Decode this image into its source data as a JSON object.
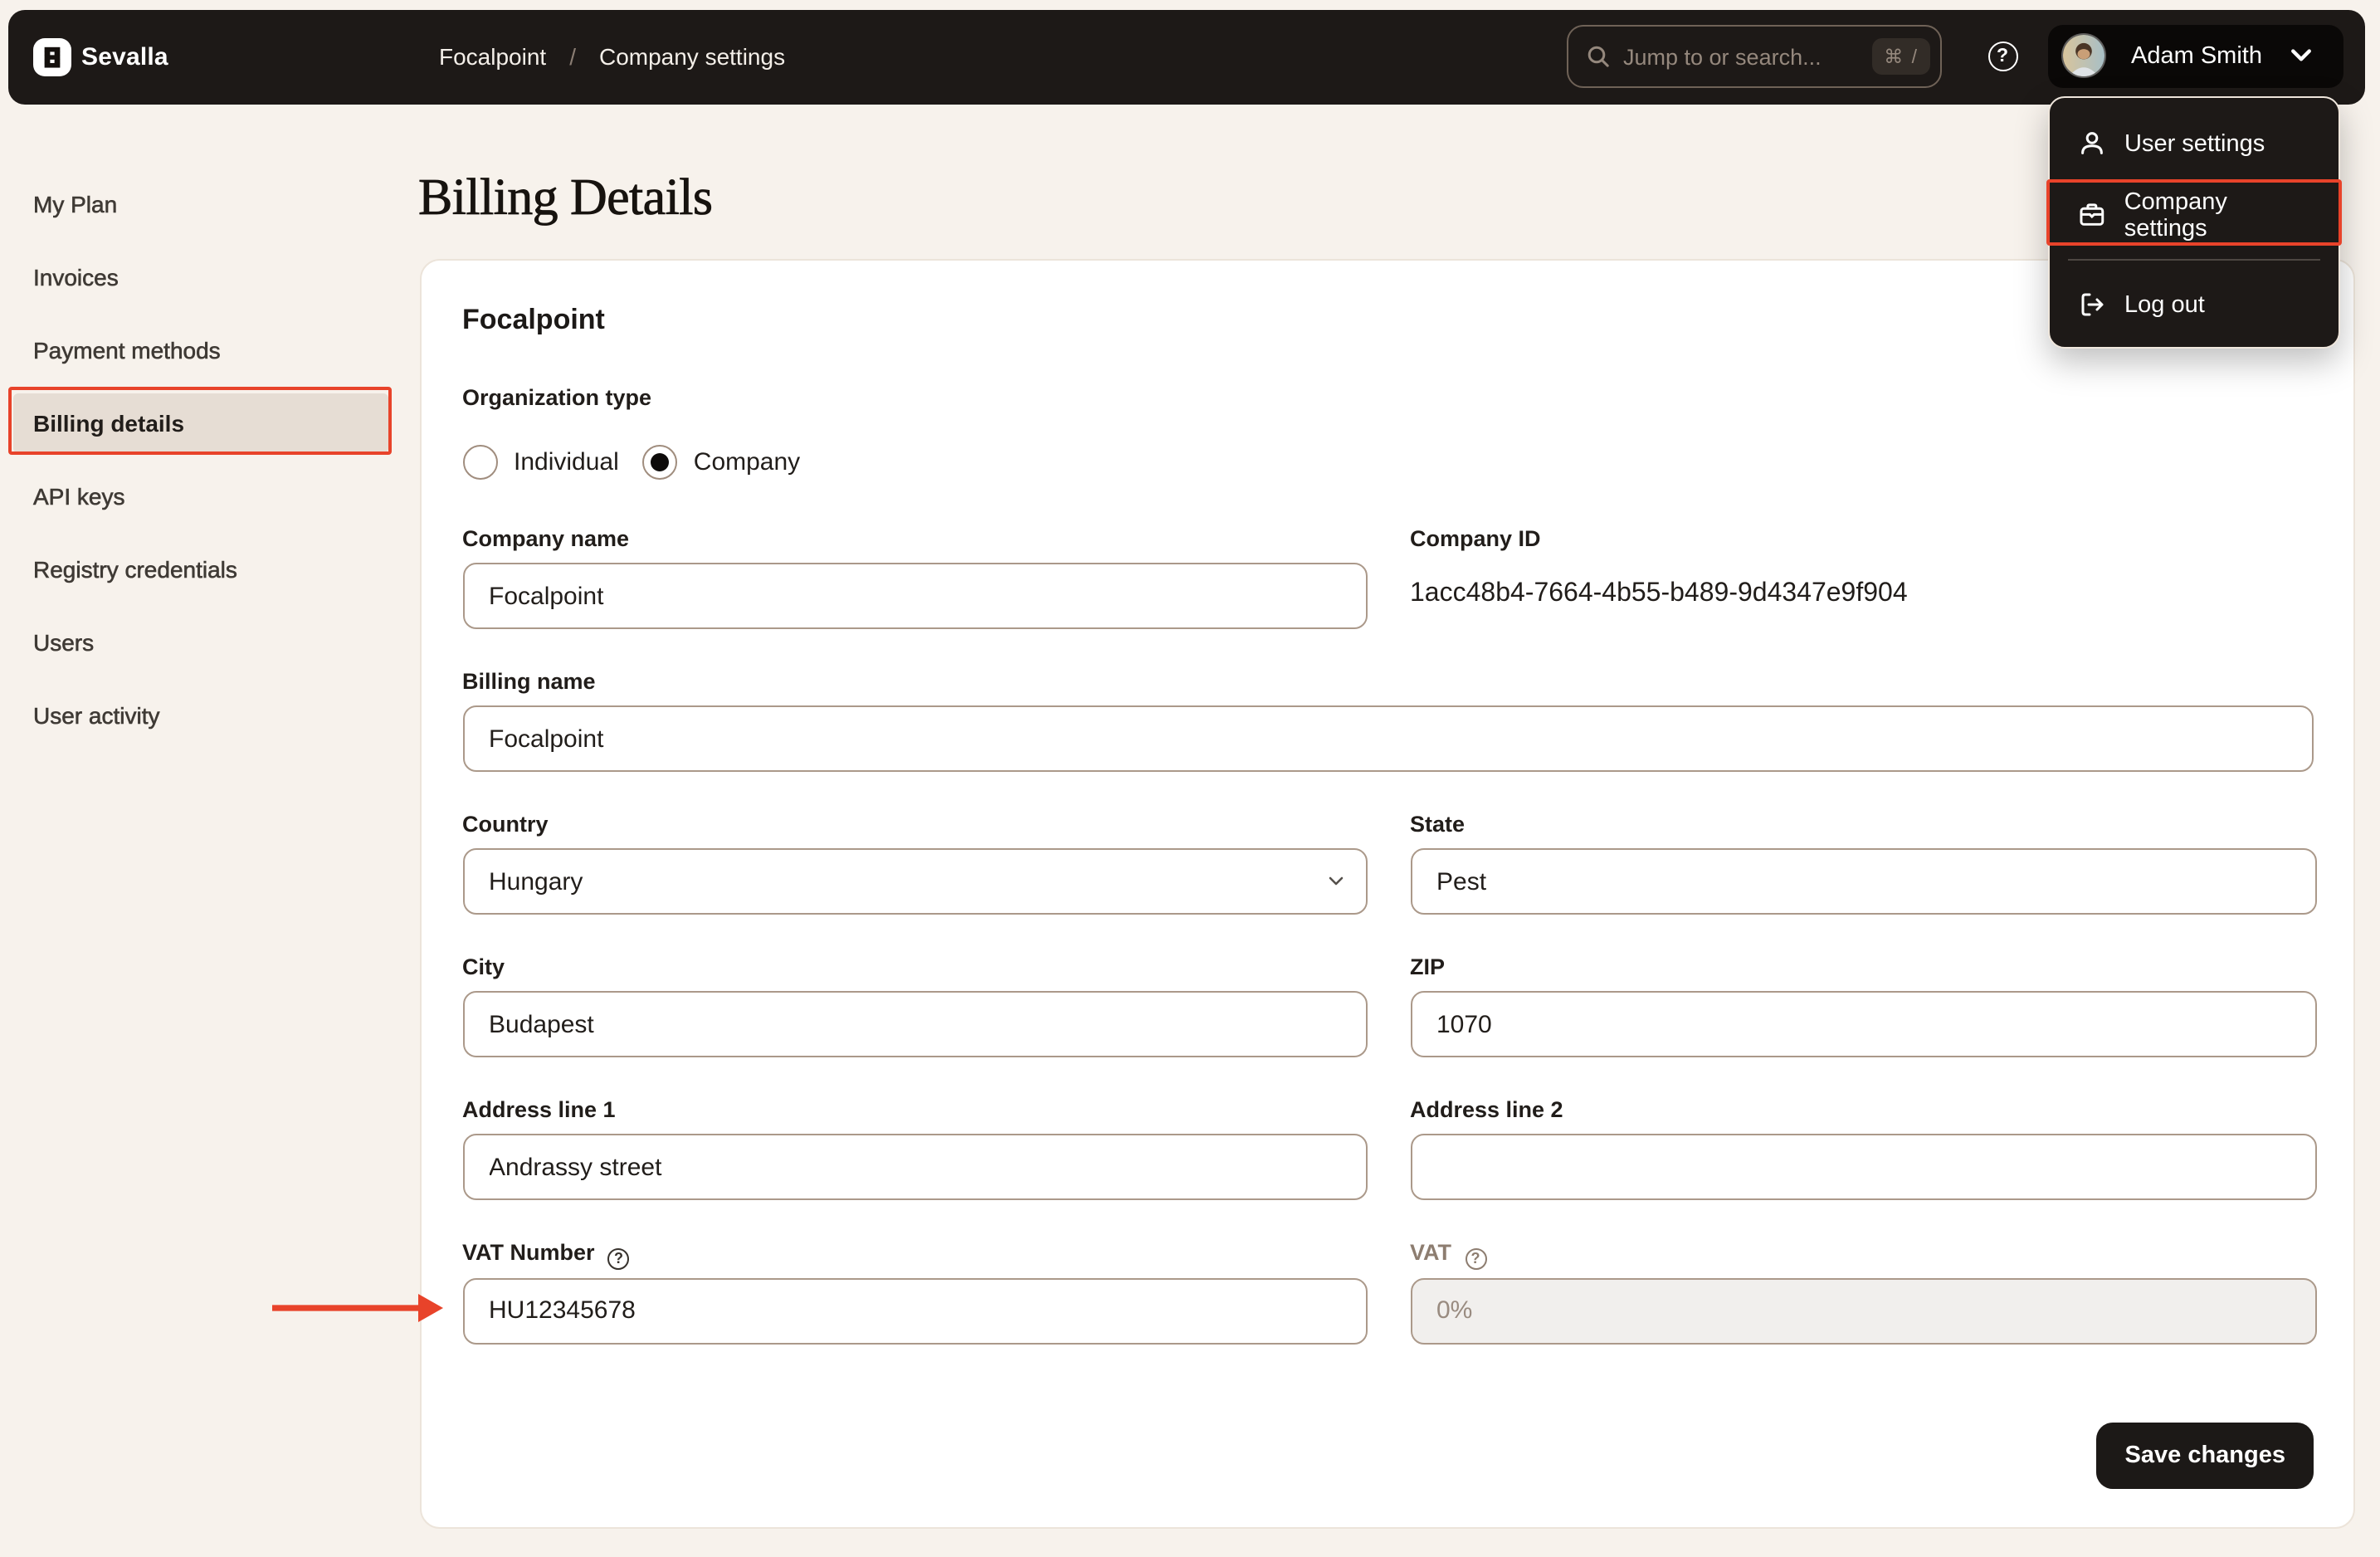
{
  "brand": {
    "name": "Sevalla"
  },
  "breadcrumb": {
    "app": "Focalpoint",
    "separator": "/",
    "page": "Company settings"
  },
  "search": {
    "placeholder": "Jump to or search...",
    "shortcut": "⌘ /"
  },
  "user": {
    "name": "Adam Smith"
  },
  "user_menu": {
    "items": [
      {
        "label": "User settings"
      },
      {
        "label": "Company settings"
      },
      {
        "label": "Log out"
      }
    ]
  },
  "sidebar": {
    "items": [
      {
        "label": "My Plan"
      },
      {
        "label": "Invoices"
      },
      {
        "label": "Payment methods"
      },
      {
        "label": "Billing details"
      },
      {
        "label": "API keys"
      },
      {
        "label": "Registry credentials"
      },
      {
        "label": "Users"
      },
      {
        "label": "User activity"
      }
    ]
  },
  "page": {
    "title": "Billing Details"
  },
  "form": {
    "card_title": "Focalpoint",
    "org_type": {
      "label": "Organization type",
      "options": [
        {
          "label": "Individual",
          "selected": false
        },
        {
          "label": "Company",
          "selected": true
        }
      ]
    },
    "company_name": {
      "label": "Company name",
      "value": "Focalpoint"
    },
    "company_id": {
      "label": "Company ID",
      "value": "1acc48b4-7664-4b55-b489-9d4347e9f904"
    },
    "billing_name": {
      "label": "Billing name",
      "value": "Focalpoint"
    },
    "country": {
      "label": "Country",
      "value": "Hungary"
    },
    "state": {
      "label": "State",
      "value": "Pest"
    },
    "city": {
      "label": "City",
      "value": "Budapest"
    },
    "zip": {
      "label": "ZIP",
      "value": "1070"
    },
    "address1": {
      "label": "Address line 1",
      "value": "Andrassy street"
    },
    "address2": {
      "label": "Address line 2",
      "value": ""
    },
    "vat_number": {
      "label": "VAT Number",
      "value": "HU12345678"
    },
    "vat": {
      "label": "VAT",
      "value": "0%"
    },
    "save_label": "Save changes"
  },
  "colors": {
    "accent_red": "#e8432a",
    "topbar": "#1d1917",
    "page_bg": "#f7f2ec"
  }
}
